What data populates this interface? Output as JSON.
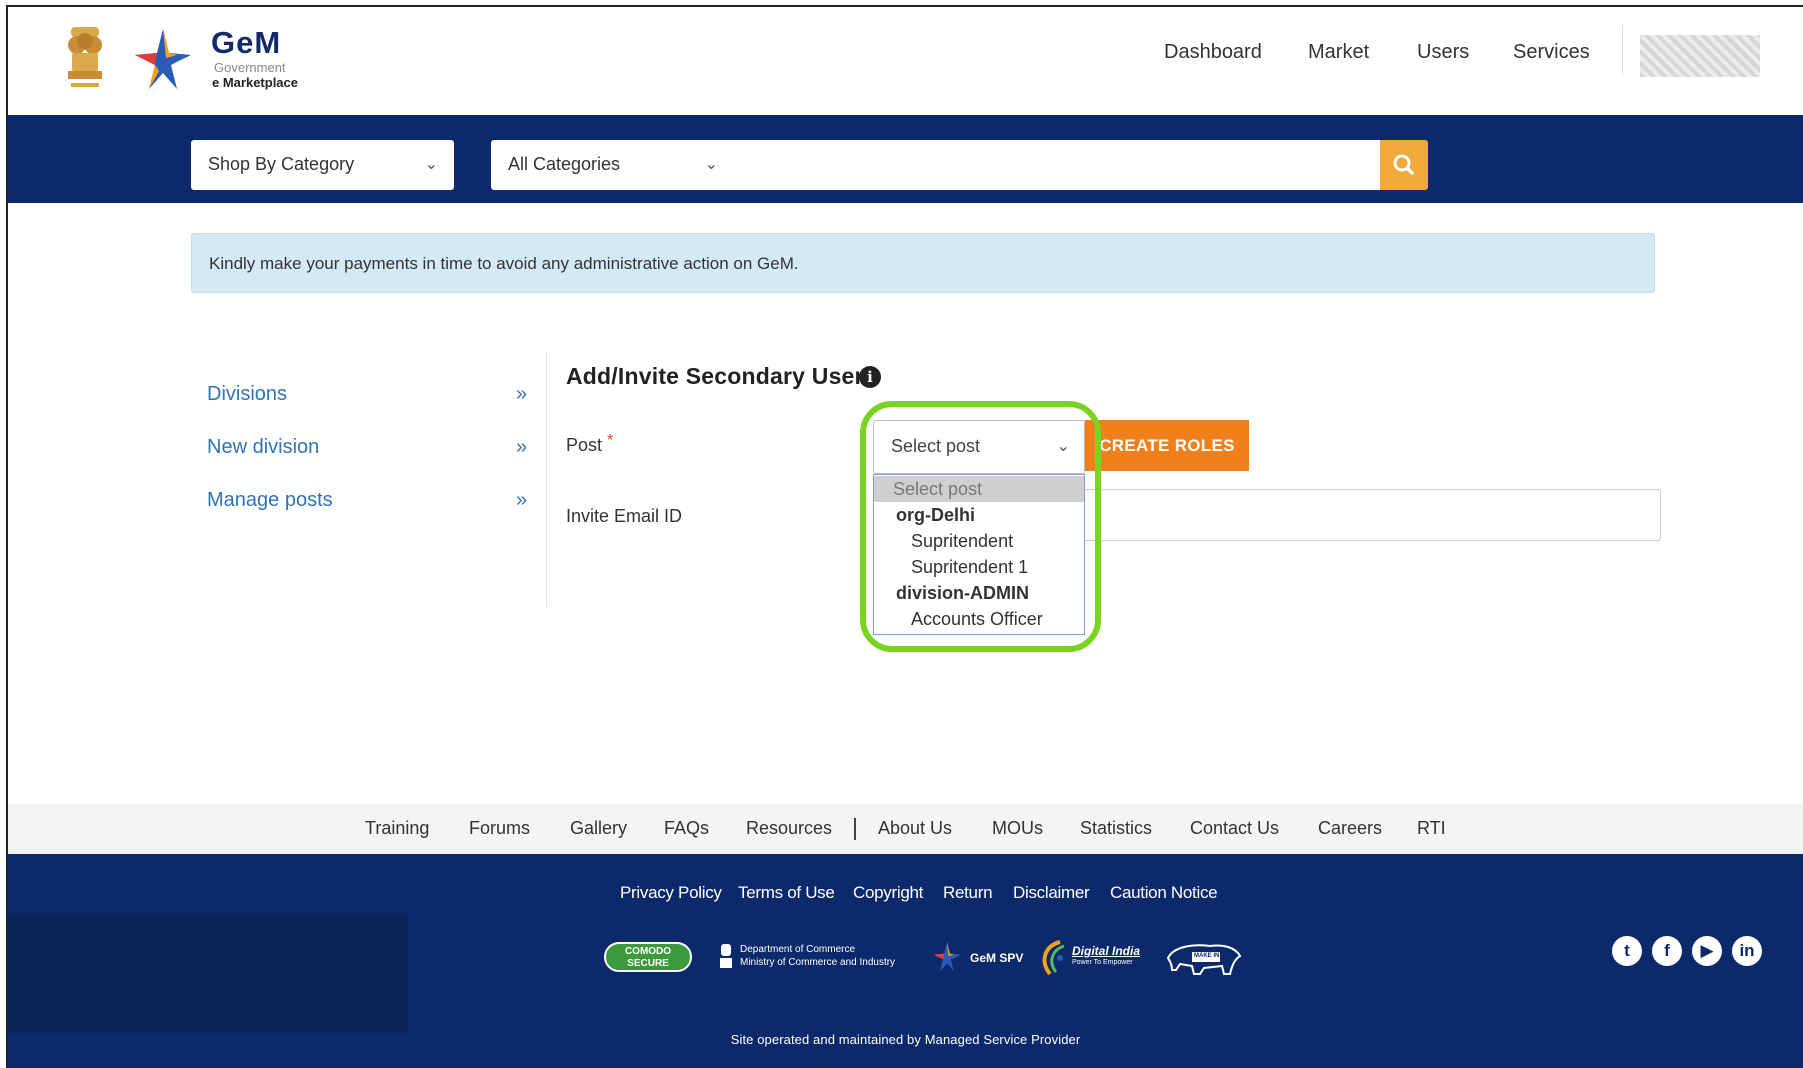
{
  "header": {
    "brand_title": "GeM",
    "brand_sub1": "Government",
    "brand_sub2": "e Marketplace",
    "nav": [
      {
        "label": "Dashboard"
      },
      {
        "label": "Market"
      },
      {
        "label": "Users"
      },
      {
        "label": "Services"
      }
    ]
  },
  "search": {
    "shop_by_category": "Shop By Category",
    "all_categories": "All Categories",
    "query": ""
  },
  "alert": {
    "text": "Kindly make your payments in time to avoid any administrative action on GeM."
  },
  "sidebar": {
    "items": [
      {
        "label": "Divisions",
        "arrow": "»"
      },
      {
        "label": "New division",
        "arrow": "»"
      },
      {
        "label": "Manage posts",
        "arrow": "»"
      }
    ]
  },
  "form": {
    "title": "Add/Invite Secondary User",
    "info_icon": "i",
    "post_label": "Post",
    "required_mark": "*",
    "post_value": "Select post",
    "create_roles_label": "CREATE ROLES",
    "email_label": "Invite Email ID",
    "email_value": ""
  },
  "post_dropdown": {
    "options": [
      {
        "label": "Select post",
        "kind": "selected"
      },
      {
        "label": "org-Delhi",
        "kind": "group"
      },
      {
        "label": "Supritendent",
        "kind": "child"
      },
      {
        "label": "Supritendent 1",
        "kind": "child"
      },
      {
        "label": "division-ADMIN",
        "kind": "group"
      },
      {
        "label": "Accounts Officer",
        "kind": "child"
      }
    ]
  },
  "footer_links": [
    {
      "label": "Training"
    },
    {
      "label": "Forums"
    },
    {
      "label": "Gallery"
    },
    {
      "label": "FAQs"
    },
    {
      "label": "Resources"
    },
    {
      "label": "About Us"
    },
    {
      "label": "MOUs"
    },
    {
      "label": "Statistics"
    },
    {
      "label": "Contact Us"
    },
    {
      "label": "Careers"
    },
    {
      "label": "RTI"
    }
  ],
  "policy_links": [
    {
      "label": "Privacy Policy"
    },
    {
      "label": "Terms of Use"
    },
    {
      "label": "Copyright"
    },
    {
      "label": "Return"
    },
    {
      "label": "Disclaimer"
    },
    {
      "label": "Caution Notice"
    }
  ],
  "partners": {
    "comodo": "COMODO SECURE",
    "commerce_line1": "Department of Commerce",
    "commerce_line2": "Ministry of Commerce and Industry",
    "gem_spv": "GeM SPV",
    "digital_india": "Digital India",
    "digital_india_tag": "Power To Empower",
    "make_in_india": "MAKE IN INDIA"
  },
  "footer": {
    "site_operated": "Site operated and maintained by Managed Service Provider"
  },
  "colors": {
    "navy": "#0c2a6b",
    "accent_orange": "#f17f1c",
    "search_orange": "#f0a93a",
    "link_blue": "#2f74b5",
    "highlight_green": "#7ad321"
  }
}
